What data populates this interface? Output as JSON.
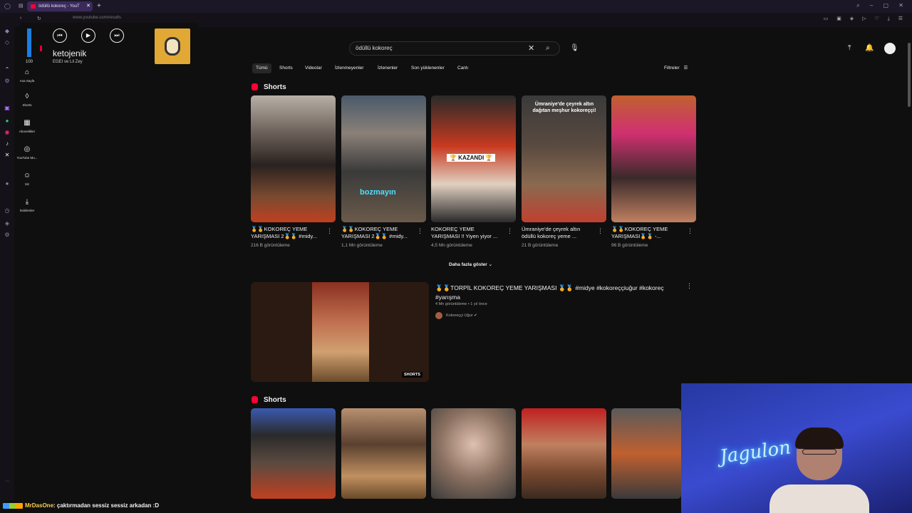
{
  "browser": {
    "tab_title": "ödüllü kokoreç - YouT",
    "tab_close": "✕",
    "new_tab": "+",
    "url": "www.youtube.com/results",
    "window_controls": "⌕ – ▢ ✕",
    "extensions": "▭ ▣ ◈ ▷ ♡ ⤓ ☰"
  },
  "media": {
    "volume": 100,
    "volume_label": "100",
    "song": "ketojenik",
    "artist": "EGEI ve Lil Zey",
    "prev": "⏮",
    "play": "▶",
    "next": "⏭"
  },
  "guide": [
    {
      "icon": "⌂",
      "label": "Ana Sayfa"
    },
    {
      "icon": "◊",
      "label": "Shorts"
    },
    {
      "icon": "▦",
      "label": "Abonelikler"
    },
    {
      "icon": "◎",
      "label": "YouTube Mu..."
    },
    {
      "icon": "☺",
      "label": "Siz"
    },
    {
      "icon": "⤓",
      "label": "İndirilenler"
    }
  ],
  "search": {
    "query": "ödüllü kokoreç",
    "clear": "✕",
    "search_icon": "⌕",
    "mic": "🎙"
  },
  "header_icons": {
    "upload": "⤒",
    "bell": "🔔"
  },
  "chips": [
    "Tümü",
    "Shorts",
    "Videolar",
    "İzlenmeyenler",
    "İzlenenler",
    "Son yüklenenler",
    "Canlı"
  ],
  "filters_label": "Filtreler",
  "shorts_section_1": {
    "heading": "Shorts",
    "items": [
      {
        "title": "🏅🏅KOKOREÇ YEME YARIŞMASI 2🏅🏅 #midy...",
        "views": "216 B görüntüleme",
        "overlay": ""
      },
      {
        "title": "🏅🏅KOKOREÇ YEME YARIŞMASI 2🏅🏅 #midy...",
        "views": "1,1 Mn görüntüleme",
        "overlay": "bozmayın"
      },
      {
        "title": "KOKOREÇ YEME YARIŞMASI !! Yiyen yiyor ...",
        "views": "4,5 Mn görüntüleme",
        "overlay": "🏆 KAZANDI 🏆"
      },
      {
        "title": "Ümraniye'de çeyrek altın ödüllü kokoreç yeme ...",
        "views": "21 B görüntüleme",
        "overlay": "Ümraniye'de çeyrek altın dağıtan meşhur kokoreççi!"
      },
      {
        "title": "🏅🏅KOKOREÇ YEME YARIŞMASI🏅🏅 -...",
        "views": "96 B görüntüleme",
        "overlay": ""
      }
    ],
    "show_more": "Daha fazla göster ⌄"
  },
  "video_result": {
    "title": "🏅🏅TORPİL KOKOREÇ YEME YARIŞMASI 🏅🏅 #midye #kokoreççiuğur #kokoreç #yarışma",
    "meta": "4 Mn görüntüleme • 1 yıl önce",
    "channel": "Kokoreççi Uğur ✔",
    "badge": "SHORTS"
  },
  "shorts_section_2": {
    "heading": "Shorts"
  },
  "chat": {
    "user": "MrDasOne",
    "message": ": çaktırmadan sessiz sessiz arkadan :D"
  },
  "webcam": {
    "neon_sign": "Jagulon"
  },
  "colors": {
    "accent": "#ff0033",
    "background": "#0f0f0f",
    "volume": "#1a7fe0"
  }
}
